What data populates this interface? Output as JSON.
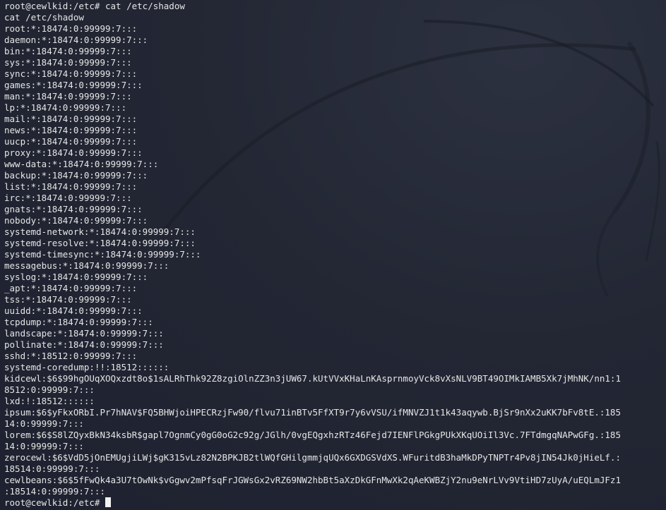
{
  "terminal": {
    "lines": [
      "root@cewlkid:/etc# cat /etc/shadow",
      "cat /etc/shadow",
      "root:*:18474:0:99999:7:::",
      "daemon:*:18474:0:99999:7:::",
      "bin:*:18474:0:99999:7:::",
      "sys:*:18474:0:99999:7:::",
      "sync:*:18474:0:99999:7:::",
      "games:*:18474:0:99999:7:::",
      "man:*:18474:0:99999:7:::",
      "lp:*:18474:0:99999:7:::",
      "mail:*:18474:0:99999:7:::",
      "news:*:18474:0:99999:7:::",
      "uucp:*:18474:0:99999:7:::",
      "proxy:*:18474:0:99999:7:::",
      "www-data:*:18474:0:99999:7:::",
      "backup:*:18474:0:99999:7:::",
      "list:*:18474:0:99999:7:::",
      "irc:*:18474:0:99999:7:::",
      "gnats:*:18474:0:99999:7:::",
      "nobody:*:18474:0:99999:7:::",
      "systemd-network:*:18474:0:99999:7:::",
      "systemd-resolve:*:18474:0:99999:7:::",
      "systemd-timesync:*:18474:0:99999:7:::",
      "messagebus:*:18474:0:99999:7:::",
      "syslog:*:18474:0:99999:7:::",
      "_apt:*:18474:0:99999:7:::",
      "tss:*:18474:0:99999:7:::",
      "uuidd:*:18474:0:99999:7:::",
      "tcpdump:*:18474:0:99999:7:::",
      "landscape:*:18474:0:99999:7:::",
      "pollinate:*:18474:0:99999:7:::",
      "sshd:*:18512:0:99999:7:::",
      "systemd-coredump:!!:18512::::::",
      "kidcewl:$6$99hgOUqXOQxzdt8o$1sALRhThk92Z8zgiOlnZZ3n3jUW67.kUtVVxKHaLnKAsprnmoyVck8vXsNLV9BT49OIMkIAMB5Xk7jMhNK/nn1:1",
      "8512:0:99999:7:::",
      "lxd:!:18512::::::",
      "ipsum:$6$yFkxORbI.Pr7hNAV$FQ5BHWjoiHPECRzjFw90/flvu71inBTv5FfXT9r7y6vVSU/ifMNVZJ1t1k43aqywb.BjSr9nXx2uKK7bFv8tE.:185",
      "14:0:99999:7:::",
      "lorem:$6$S8lZQyxBkN34ksbR$gapl7OgnmCy0gG0oG2c92g/JGlh/0vgEQgxhzRTz46Fejd7IENFlPGkgPUkXKqUOiIl3Vc.7FTdmgqNAPwGFg.:185",
      "14:0:99999:7:::",
      "zerocewl:$6$VdD5jOnEMUgjiLWj$gK315vLz82N2BPKJB2tlWQfGHilgmmjqUQx6GXDGSVdXS.WFuritdB3haMkDPyTNPTr4Pv8jIN54Jk0jHieLf.:",
      "18514:0:99999:7:::",
      "cewlbeans:$6$5fFwQk4a3U7tOwNk$vGgwv2mPfsqFrJGWsGx2vRZ69NW2hbBt5aXzDkGFnMwXk2qAeKWBZjY2nu9eNrLVv9VtiHD7zUyA/uEQLmJFz1",
      ":18514:0:99999:7:::"
    ],
    "prompt": "root@cewlkid:/etc# ",
    "colors": {
      "background": "#232734",
      "text": "#e6e6e6",
      "cursor": "#f2f2f2"
    },
    "icons": {
      "background": "kali-dragon-emblem",
      "cursor": "block-cursor"
    }
  }
}
